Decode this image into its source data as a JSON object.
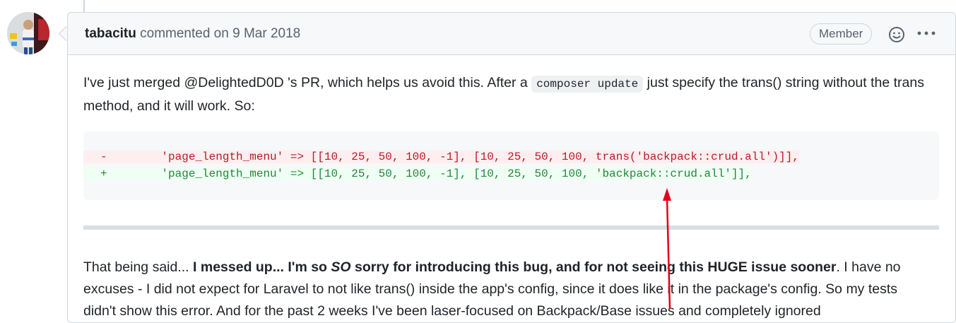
{
  "comment": {
    "author": "tabacitu",
    "action": "commented on",
    "date": "9 Mar 2018",
    "role_badge": "Member",
    "paragraph1": {
      "before": "I've just merged @DelightedD0D 's PR, which helps us avoid this. After a ",
      "code": "composer update",
      "after": " just specify the trans() string without the trans method, and it will work. So:"
    },
    "diff": {
      "removed_marker": "-",
      "removed": "        'page_length_menu' => [[10, 25, 50, 100, -1], [10, 25, 50, 100, trans('backpack::crud.all')]],",
      "added_marker": "+",
      "added": "        'page_length_menu' => [[10, 25, 50, 100, -1], [10, 25, 50, 100, 'backpack::crud.all']],"
    },
    "paragraph2": {
      "intro": "That being said... ",
      "bold_a": "I messed up... I'm so ",
      "bold_em": "SO",
      "bold_b": " sorry for introducing this bug, and for not seeing this HUGE issue sooner",
      "rest": ". I have no excuses - I did not expect for Laravel to not like trans() inside the app's config, since it does like it in the package's config. So my tests didn't show this error. And for the past 2 weeks I've been laser-focused on Backpack/Base issues and completely ignored"
    }
  },
  "icons": {
    "reaction": "smiley-icon",
    "more": "kebab-horizontal-icon"
  },
  "colors": {
    "diff_removed": "#b31d28",
    "diff_added": "#22863a",
    "annotation_arrow": "#e3001b"
  }
}
